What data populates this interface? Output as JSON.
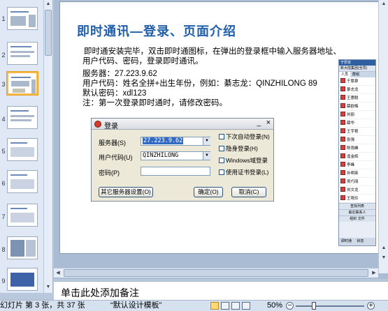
{
  "slide": {
    "title": "即时通讯—登录、页面介绍",
    "lines": [
      "即时通安装完毕，双击即时通图标，在弹出的登录框中输入服务器地址、",
      "用户代码、密码，登录即时通讯。",
      "服务器：27.223.9.62",
      "用户代码：姓名全拼+出生年份，例如：綦志龙：QINZHILONG 89",
      "默认密码：xdl123",
      "注：第一次登录即时通时，请修改密码。"
    ]
  },
  "login_dialog": {
    "title": "登录",
    "minimize": "_",
    "close": "×",
    "server_label": "服务器(S)",
    "server_value": "27.223.9.62",
    "user_label": "用户代码(U)",
    "user_value": "QINZHILONG",
    "password_label": "密码(P)",
    "password_value": "",
    "auto_login": "下次自动登录(N)",
    "hidden_login": "隐身登录(H)",
    "windows_login": "Windows域登录",
    "cert_login": "使用证书登录(L)",
    "other_settings": "其它服务器设置(O)",
    "ok": "确定(O)",
    "cancel": "取消(C)"
  },
  "im_panel": {
    "header": "于厚泉",
    "bar": "新大陆集团(全员)",
    "tabs": [
      "人员",
      "群组"
    ],
    "contacts": [
      "于厚泉",
      "綦志龙",
      "王惠聪",
      "薛欧梅",
      "刘丽",
      "薛华",
      "王宇艳",
      "张强",
      "陈雨峰",
      "逢金辉",
      "李峰",
      "孙明英",
      "吴巧丽",
      "刘文龙",
      "王艳玲"
    ],
    "search": "查找列表",
    "recent": "最近联系人",
    "group_btn": "组织",
    "file_btn": "文件",
    "footer_left": "即时通",
    "footer_right": "状态"
  },
  "thumbnails": {
    "numbers": [
      "1",
      "2",
      "3",
      "4",
      "5",
      "6",
      "7",
      "8",
      "9"
    ],
    "selected_index": 3
  },
  "notes": {
    "placeholder": "单击此处添加备注"
  },
  "status": {
    "slide_info": "幻灯片 第 3 张，共 37 张",
    "theme": "“默认设计模板”",
    "zoom": "50%",
    "zoom_minus": "−",
    "zoom_plus": "+"
  }
}
